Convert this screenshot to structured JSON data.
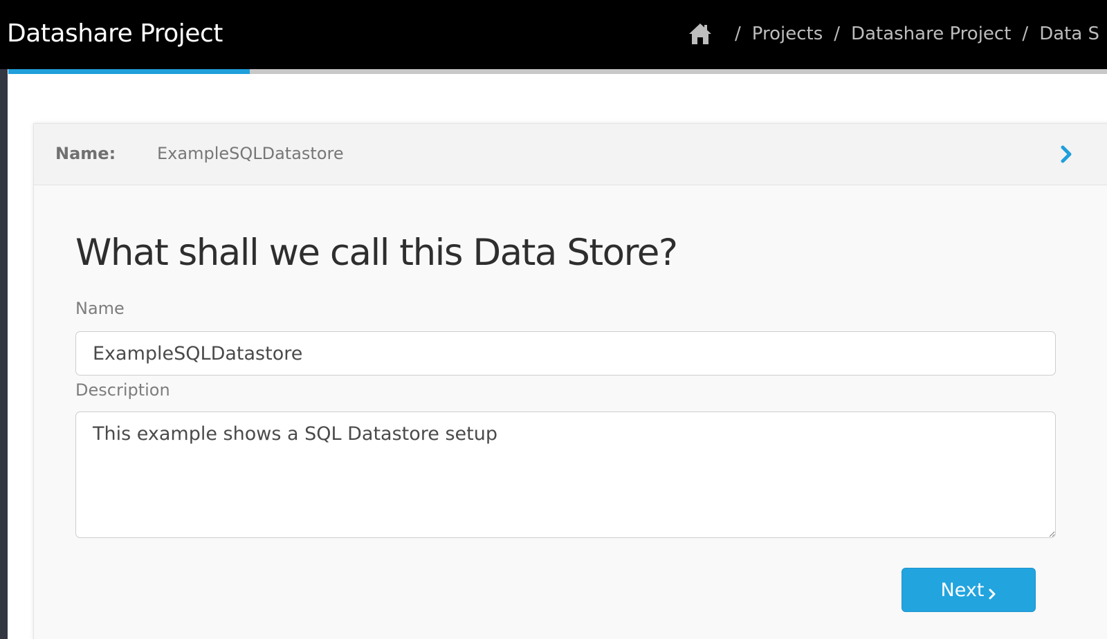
{
  "app": {
    "title": "Datashare Project"
  },
  "breadcrumb": {
    "home_icon": "home-icon",
    "separator": "/",
    "items": [
      "Projects",
      "Datashare Project",
      "Data S"
    ]
  },
  "progress": {
    "fraction": 0.22,
    "color": "#1f9fdb"
  },
  "summary": {
    "name_label": "Name:",
    "name_value": "ExampleSQLDatastore",
    "expand_icon": "chevron-right-icon"
  },
  "form": {
    "title": "What shall we call this Data Store?",
    "name_label": "Name",
    "name_value": "ExampleSQLDatastore",
    "description_label": "Description",
    "description_value": "This example shows a SQL Datastore setup",
    "next_label": "Next",
    "next_icon": "chevron-right-icon"
  },
  "colors": {
    "topbar": "#000000",
    "accent": "#22a4df",
    "rail": "#333742"
  }
}
